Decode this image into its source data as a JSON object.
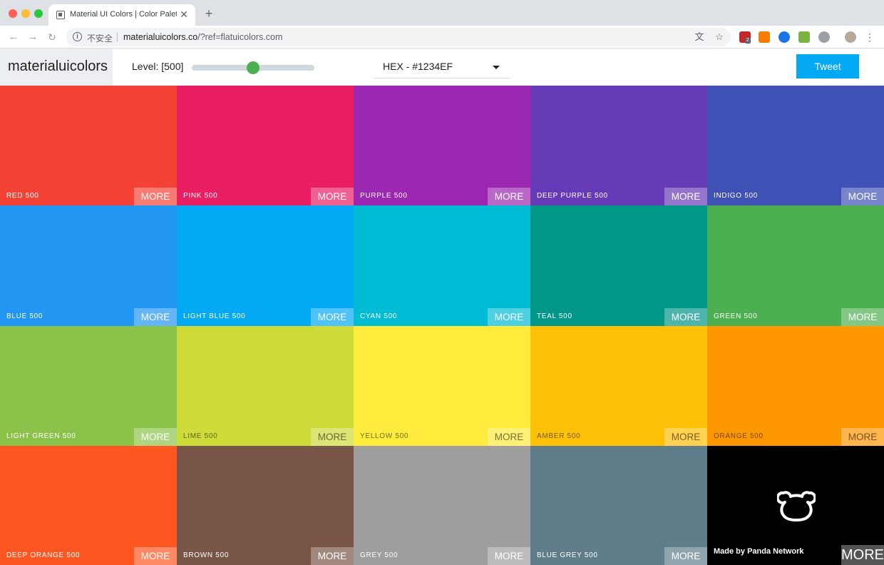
{
  "browser": {
    "tab_title": "Material UI Colors | Color Palet",
    "close_glyph": "✕",
    "new_tab_glyph": "+",
    "insecure_label": "不安全",
    "url_host": "materialuicolors.co",
    "url_rest": "/?ref=flatuicolors.com",
    "ext_badge": "2"
  },
  "header": {
    "logo": "materialuicolors",
    "level_label": "Level: [500]",
    "level_fraction": 0.5,
    "format_value": "HEX - #1234EF",
    "tweet_label": "Tweet",
    "accent": "#03a9f4",
    "slider_color": "#4caf50"
  },
  "grid": {
    "more_label": "MORE",
    "colors": [
      {
        "name": "RED 500",
        "hex": "#f44336"
      },
      {
        "name": "PINK 500",
        "hex": "#e91e63"
      },
      {
        "name": "PURPLE 500",
        "hex": "#9c27b0"
      },
      {
        "name": "DEEP PURPLE 500",
        "hex": "#673ab7"
      },
      {
        "name": "INDIGO 500",
        "hex": "#3f51b5"
      },
      {
        "name": "BLUE 500",
        "hex": "#2196f3"
      },
      {
        "name": "LIGHT BLUE 500",
        "hex": "#03a9f4"
      },
      {
        "name": "CYAN 500",
        "hex": "#00bcd4"
      },
      {
        "name": "TEAL 500",
        "hex": "#009688"
      },
      {
        "name": "GREEN 500",
        "hex": "#4caf50"
      },
      {
        "name": "LIGHT GREEN 500",
        "hex": "#8bc34a"
      },
      {
        "name": "LIME 500",
        "hex": "#cddc39"
      },
      {
        "name": "YELLOW 500",
        "hex": "#ffeb3b"
      },
      {
        "name": "AMBER 500",
        "hex": "#ffc107"
      },
      {
        "name": "ORANGE 500",
        "hex": "#ff9800"
      },
      {
        "name": "DEEP ORANGE 500",
        "hex": "#ff5722"
      },
      {
        "name": "BROWN 500",
        "hex": "#795548"
      },
      {
        "name": "GREY 500",
        "hex": "#9e9e9e"
      },
      {
        "name": "BLUE GREY 500",
        "hex": "#607d8b"
      }
    ],
    "promo": {
      "credit": "Made by Panda Network",
      "hex": "#000000"
    }
  }
}
